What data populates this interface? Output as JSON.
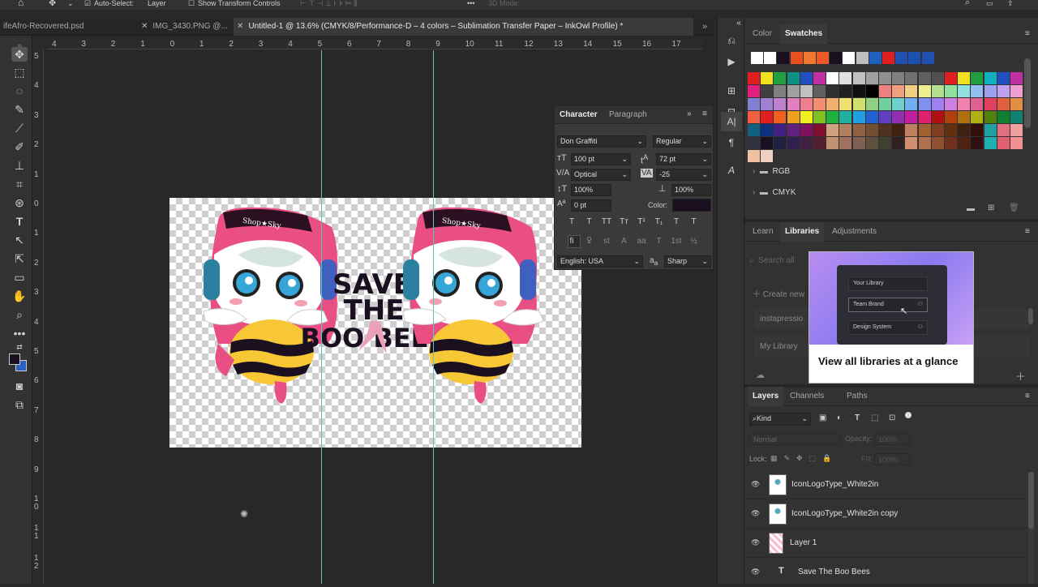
{
  "optionsbar": {
    "auto_select_label": "Auto-Select:",
    "auto_select_value": "Layer",
    "show_transform_label": "Show Transform Controls",
    "mode_3d_label": "3D Mode:"
  },
  "tabs": [
    {
      "label": "ifeAfro-Recovered.psd"
    },
    {
      "label": "IMG_3430.PNG @..."
    },
    {
      "label": "Untitled-1 @ 13.6% (CMYK/8/Performance-D – 4 colors – Sublimation Transfer Paper – InkOwl Profile) *"
    }
  ],
  "hruler_labels": [
    "4",
    "3",
    "2",
    "1",
    "0",
    "1",
    "2",
    "3",
    "4",
    "5",
    "6",
    "7",
    "8",
    "9",
    "10",
    "11",
    "12",
    "13",
    "14",
    "15",
    "16",
    "17"
  ],
  "vruler_labels": [
    "5",
    "4",
    "3",
    "2",
    "1",
    "0",
    "1",
    "2",
    "3",
    "4",
    "5",
    "6",
    "7",
    "8",
    "9",
    "1\n0",
    "1\n1",
    "1\n2"
  ],
  "canvas": {
    "title_line1": "SAVE",
    "title_line2": "THE",
    "title_line3": "BOO BEES",
    "headband_text": "Shop★Sky"
  },
  "character_panel": {
    "tab_character": "Character",
    "tab_paragraph": "Paragraph",
    "font_family": "Don Graffiti",
    "font_style": "Regular",
    "font_size": "100 pt",
    "leading": "72 pt",
    "kerning": "Optical",
    "tracking": "-25",
    "vscale": "100%",
    "hscale": "100%",
    "baseline": "0 pt",
    "color_label": "Color:",
    "text_color": "#1a1020",
    "language": "English: USA",
    "aa_label": "aₐ",
    "antialias": "Sharp",
    "type_buttons": [
      "T",
      "T",
      "TT",
      "Tт",
      "T¹",
      "T₁",
      "T",
      "T"
    ],
    "ot_buttons": [
      "fi",
      "ꝿ",
      "st",
      "A",
      "aa",
      "T",
      "1st",
      "½"
    ]
  },
  "color_panel": {
    "tab_color": "Color",
    "tab_swatches": "Swatches",
    "folder_rgb": "RGB",
    "folder_cmyk": "CMYK"
  },
  "swatches_row0": [
    "#ffffff",
    "#ffffff",
    "#1a1020",
    "#e8501e",
    "#f07a30",
    "#ee5a28",
    "#1a1020",
    "#ffffff",
    "#bfbfbf",
    "#2060c0",
    "#e02020",
    "#2050b0",
    "#1a50b0",
    "#2050b0"
  ],
  "swatches_rows": [
    [
      "#e02020",
      "#f0e020",
      "#20a040",
      "#109080",
      "#2050c0",
      "#c030a0",
      "#ffffff",
      "#e0e0e0",
      "#c0c0c0",
      "#a0a0a0",
      "#909090",
      "#808080",
      "#707070",
      "#606060",
      "#505050",
      "#e02020",
      "#f0e020",
      "#20a040",
      "#10b0c0",
      "#2050c0",
      "#c030a0"
    ],
    [
      "#e02080",
      "#404040",
      "#808080",
      "#a0a0a0",
      "#c0c0c0",
      "#606060",
      "#303030",
      "#202020",
      "#101010",
      "#000000",
      "#f08080",
      "#f0a080",
      "#f0d080",
      "#f0f090",
      "#b0e090",
      "#90e0a0",
      "#90e0e0",
      "#90c0f0",
      "#a0a0f0",
      "#c0a0f0",
      "#f0a0d0"
    ],
    [
      "#8080d0",
      "#a080d0",
      "#c080d0",
      "#e080c0",
      "#f08090",
      "#f09070",
      "#f0b070",
      "#f0e070",
      "#d0e070",
      "#90d080",
      "#70d0a0",
      "#70d0d0",
      "#70b0f0",
      "#8090f0",
      "#a080f0",
      "#d080e0",
      "#f080b0",
      "#e06090",
      "#e04060",
      "#e06040",
      "#e09040"
    ],
    [
      "#f06040",
      "#e02020",
      "#f06020",
      "#f0a020",
      "#f0f020",
      "#80c020",
      "#20b040",
      "#20b0a0",
      "#20a0e0",
      "#2060d0",
      "#6040c0",
      "#9030b0",
      "#c020a0",
      "#e02070",
      "#b01010",
      "#b04010",
      "#b07010",
      "#b0b010",
      "#508010",
      "#108030",
      "#108070"
    ],
    [
      "#106080",
      "#103080",
      "#402080",
      "#602080",
      "#801060",
      "#801030",
      "#d0a080",
      "#b08060",
      "#906040",
      "#705030",
      "#503020",
      "#402010",
      "#c08060",
      "#a06030",
      "#804020",
      "#603010",
      "#402010",
      "#301008",
      "#20a0a0",
      "#e07080",
      "#f0a0a0"
    ],
    [
      "#303040",
      "#1a1020",
      "#202040",
      "#302050",
      "#402040",
      "#502030",
      "#c09070",
      "#a07060",
      "#806050",
      "#605040",
      "#404030",
      "#302020",
      "#d09070",
      "#b07050",
      "#905030",
      "#703020",
      "#502010",
      "#301010",
      "#20b0b0",
      "#e06070",
      "#f09090"
    ],
    [
      "#f0c0a0",
      "#f0d0c0"
    ]
  ],
  "learn_panel": {
    "tab_learn": "Learn",
    "tab_libraries": "Libraries",
    "tab_adjustments": "Adjustments",
    "search_placeholder": "Search all",
    "create_new": "Create new",
    "lib_item1": "instapressio",
    "lib_item2": "My Library",
    "card_row1": "Your Library",
    "card_row2": "Team Brand",
    "card_row3": "Design System",
    "card_heading": "View all libraries at a glance"
  },
  "layers_panel": {
    "tab_layers": "Layers",
    "tab_channels": "Channels",
    "tab_paths": "Paths",
    "filter_kind": "Kind",
    "blend_mode": "Normal",
    "opacity_label": "Opacity:",
    "opacity_value": "100%",
    "lock_label": "Lock:",
    "fill_label": "Fill:",
    "fill_value": "100%",
    "layers": [
      {
        "name": "IconLogoType_White2in",
        "kind": "image"
      },
      {
        "name": "IconLogoType_White2in copy",
        "kind": "image"
      },
      {
        "name": "Layer 1",
        "kind": "pixel"
      },
      {
        "name": "Save  The Boo Bees",
        "kind": "text"
      }
    ]
  }
}
